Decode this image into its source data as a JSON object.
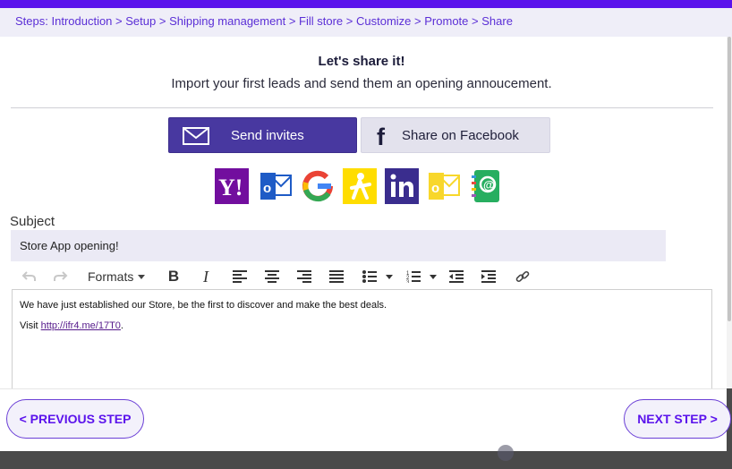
{
  "breadcrumb": {
    "prefix": "Steps:",
    "items": [
      "Introduction",
      "Setup",
      "Shipping management",
      "Fill store",
      "Customize",
      "Promote",
      "Share"
    ],
    "separator": ">"
  },
  "header": {
    "title": "Let's share it!",
    "subtitle": "Import your first leads and send them an opening annoucement."
  },
  "actions": {
    "send_invites": "Send invites",
    "share_facebook": "Share on Facebook"
  },
  "providers": [
    "yahoo-icon",
    "outlook-icon",
    "google-icon",
    "aim-icon",
    "linkedin-icon",
    "office-outlook-icon",
    "address-book-icon"
  ],
  "subject": {
    "label": "Subject",
    "value": "Store App opening!"
  },
  "editor": {
    "toolbar": {
      "formats_label": "Formats"
    },
    "line1": "We have just established our Store, be the first to discover and make the best deals.",
    "line2_prefix": "Visit",
    "link": "http://ifr4.me/17T0",
    "line2_suffix": "."
  },
  "navigation": {
    "previous": "< PREVIOUS STEP",
    "next": "NEXT STEP >"
  },
  "colors": {
    "accent": "#5b13ec",
    "send_button": "#4838a0",
    "facebook_button": "#e3e2ed",
    "input_bg": "#ebeaf5"
  }
}
